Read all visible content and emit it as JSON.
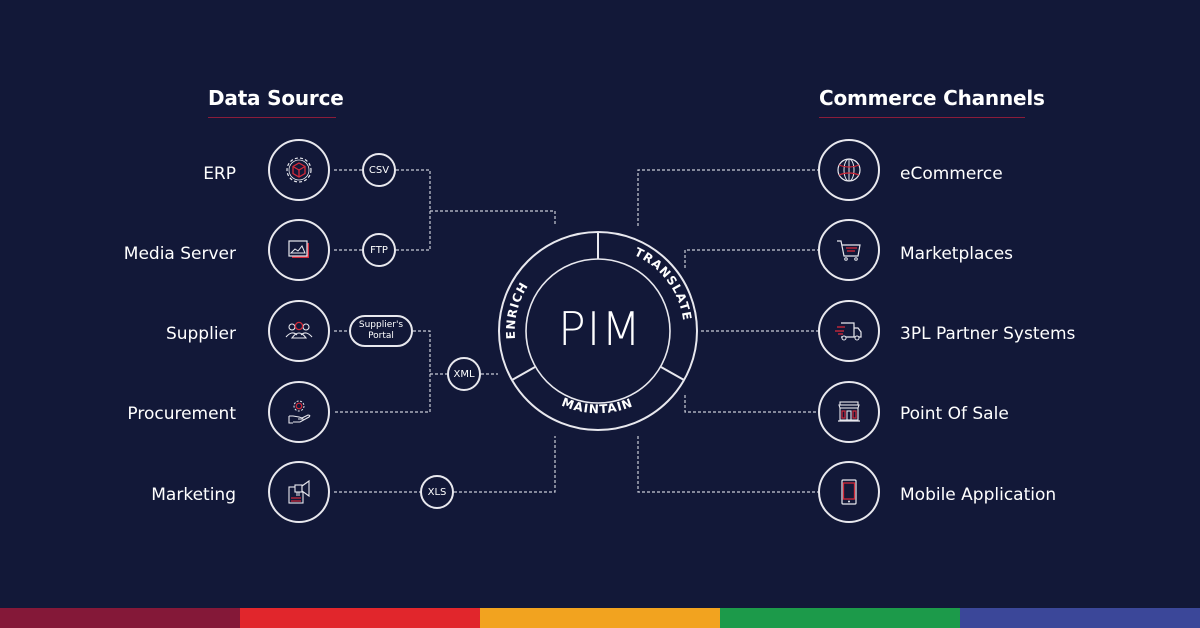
{
  "left_heading": "Data Source",
  "right_heading": "Commerce Channels",
  "center": {
    "title": "PIM",
    "segments": [
      "ENRICH",
      "TRANSLATE",
      "MAINTAIN"
    ]
  },
  "data_sources": [
    {
      "label": "ERP",
      "icon": "gear-cube-icon",
      "format": "CSV"
    },
    {
      "label": "Media Server",
      "icon": "image-gallery-icon",
      "format": "FTP"
    },
    {
      "label": "Supplier",
      "icon": "people-group-icon",
      "format": "Supplier's Portal"
    },
    {
      "label": "Procurement",
      "icon": "hand-gear-icon",
      "format": ""
    },
    {
      "label": "Marketing",
      "icon": "megaphone-document-icon",
      "format": "XLS"
    }
  ],
  "shared_formats": {
    "supplier_procurement": "XML"
  },
  "channels": [
    {
      "label": "eCommerce",
      "icon": "globe-icon"
    },
    {
      "label": "Marketplaces",
      "icon": "shopping-cart-icon"
    },
    {
      "label": "3PL Partner Systems",
      "icon": "delivery-truck-icon"
    },
    {
      "label": "Point Of Sale",
      "icon": "storefront-icon"
    },
    {
      "label": "Mobile Application",
      "icon": "smartphone-icon"
    }
  ],
  "colors": {
    "background": "#121838",
    "accent_red": "#d42a3a",
    "underline": "#8a1c3a",
    "line": "#e8e8ee",
    "bar": [
      "#841838",
      "#e1262c",
      "#f2a31f",
      "#1c9a4a",
      "#3b4799"
    ]
  }
}
